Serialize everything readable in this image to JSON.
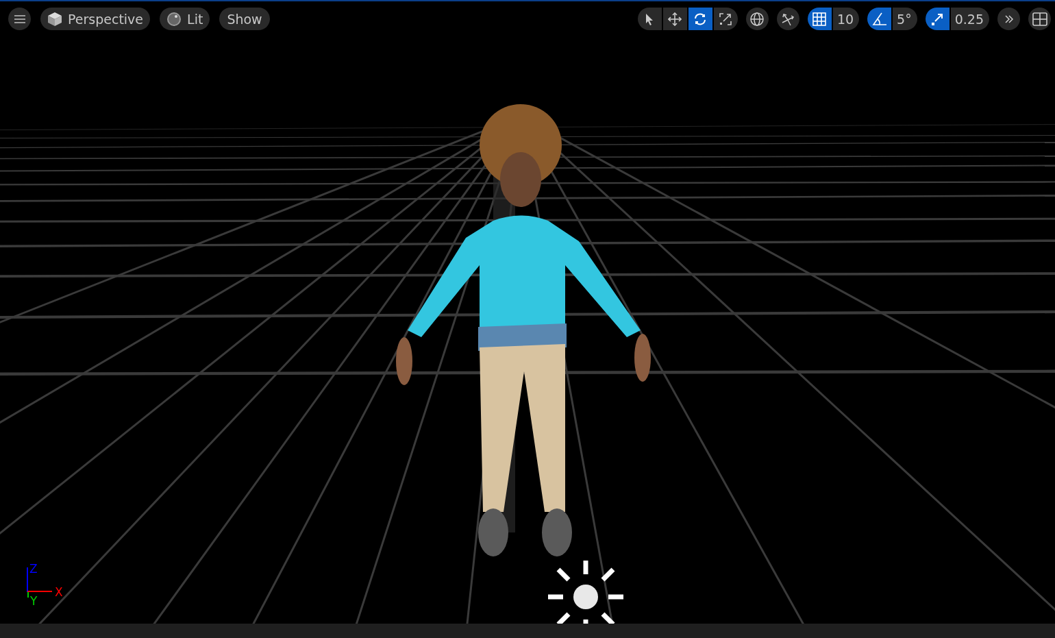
{
  "view_buttons": [
    {
      "kind": "perspective",
      "label": "Perspective"
    },
    {
      "kind": "lit",
      "label": "Lit"
    },
    {
      "kind": "show",
      "label": "Show"
    }
  ],
  "transform_tools": [
    {
      "kind": "select",
      "selected": false
    },
    {
      "kind": "move",
      "selected": false
    },
    {
      "kind": "rotate",
      "selected": true
    },
    {
      "kind": "scale",
      "selected": false
    }
  ],
  "snaps": [
    {
      "kind": "grid",
      "on": true,
      "value": "10"
    },
    {
      "kind": "angle",
      "on": true,
      "value": "5°"
    },
    {
      "kind": "scale",
      "on": true,
      "value": "0.25"
    }
  ],
  "axis_gizmo": {
    "z": "Z",
    "x": "X",
    "y": "Y"
  }
}
